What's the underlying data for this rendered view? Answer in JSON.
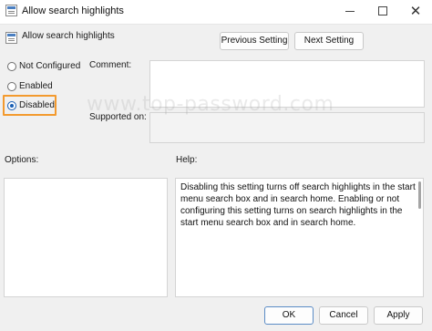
{
  "window": {
    "title": "Allow search highlights",
    "minimize_icon": "minimize-icon",
    "maximize_icon": "maximize-icon",
    "close_glyph": "✕"
  },
  "header": {
    "title": "Allow search highlights",
    "previous_label": "Previous Setting",
    "next_label": "Next Setting"
  },
  "state": {
    "options": [
      {
        "label": "Not Configured",
        "checked": false
      },
      {
        "label": "Enabled",
        "checked": false
      },
      {
        "label": "Disabled",
        "checked": true
      }
    ],
    "highlight_color": "#f39a2e"
  },
  "fields": {
    "comment_label": "Comment:",
    "comment_value": "",
    "supported_label": "Supported on:",
    "supported_value": ""
  },
  "panes": {
    "options_label": "Options:",
    "help_label": "Help:",
    "help_text": "Disabling this setting turns off search highlights in the start menu search box and in search home. Enabling or not configuring this setting turns on search highlights in the start menu search box and in search home."
  },
  "footer": {
    "ok_label": "OK",
    "cancel_label": "Cancel",
    "apply_label": "Apply"
  },
  "watermark": "www.top-password.com",
  "colors": {
    "accent": "#1a5fb4",
    "background": "#f0f0f0"
  }
}
